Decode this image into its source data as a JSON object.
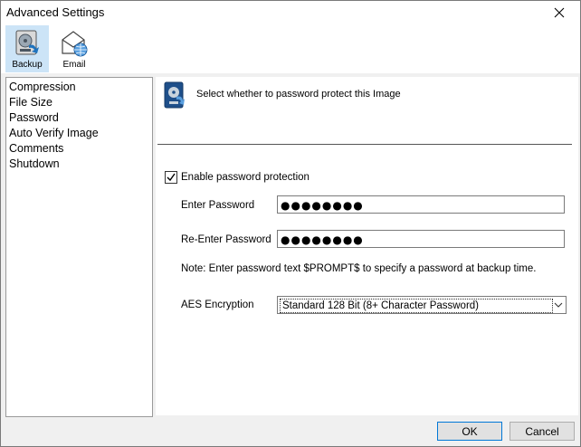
{
  "window": {
    "title": "Advanced Settings"
  },
  "toolbar": {
    "backup_label": "Backup",
    "email_label": "Email"
  },
  "sidebar": {
    "items": [
      {
        "label": "Compression"
      },
      {
        "label": "File Size"
      },
      {
        "label": "Password"
      },
      {
        "label": "Auto Verify Image"
      },
      {
        "label": "Comments"
      },
      {
        "label": "Shutdown"
      }
    ]
  },
  "content": {
    "header_text": "Select whether to password protect this Image",
    "enable_label": "Enable password protection",
    "enable_checked": true,
    "password_label": "Enter Password",
    "password_value": "●●●●●●●●",
    "reenter_label": "Re-Enter Password",
    "reenter_value": "●●●●●●●●",
    "note": "Note: Enter password text $PROMPT$ to specify a password at backup time.",
    "aes_label": "AES Encryption",
    "aes_value": "Standard 128 Bit (8+ Character Password)"
  },
  "footer": {
    "ok_label": "OK",
    "cancel_label": "Cancel"
  },
  "colors": {
    "selected_toolbar_bg": "#cce4f7",
    "primary_border": "#0078d7",
    "icon_blue": "#1e73be"
  }
}
